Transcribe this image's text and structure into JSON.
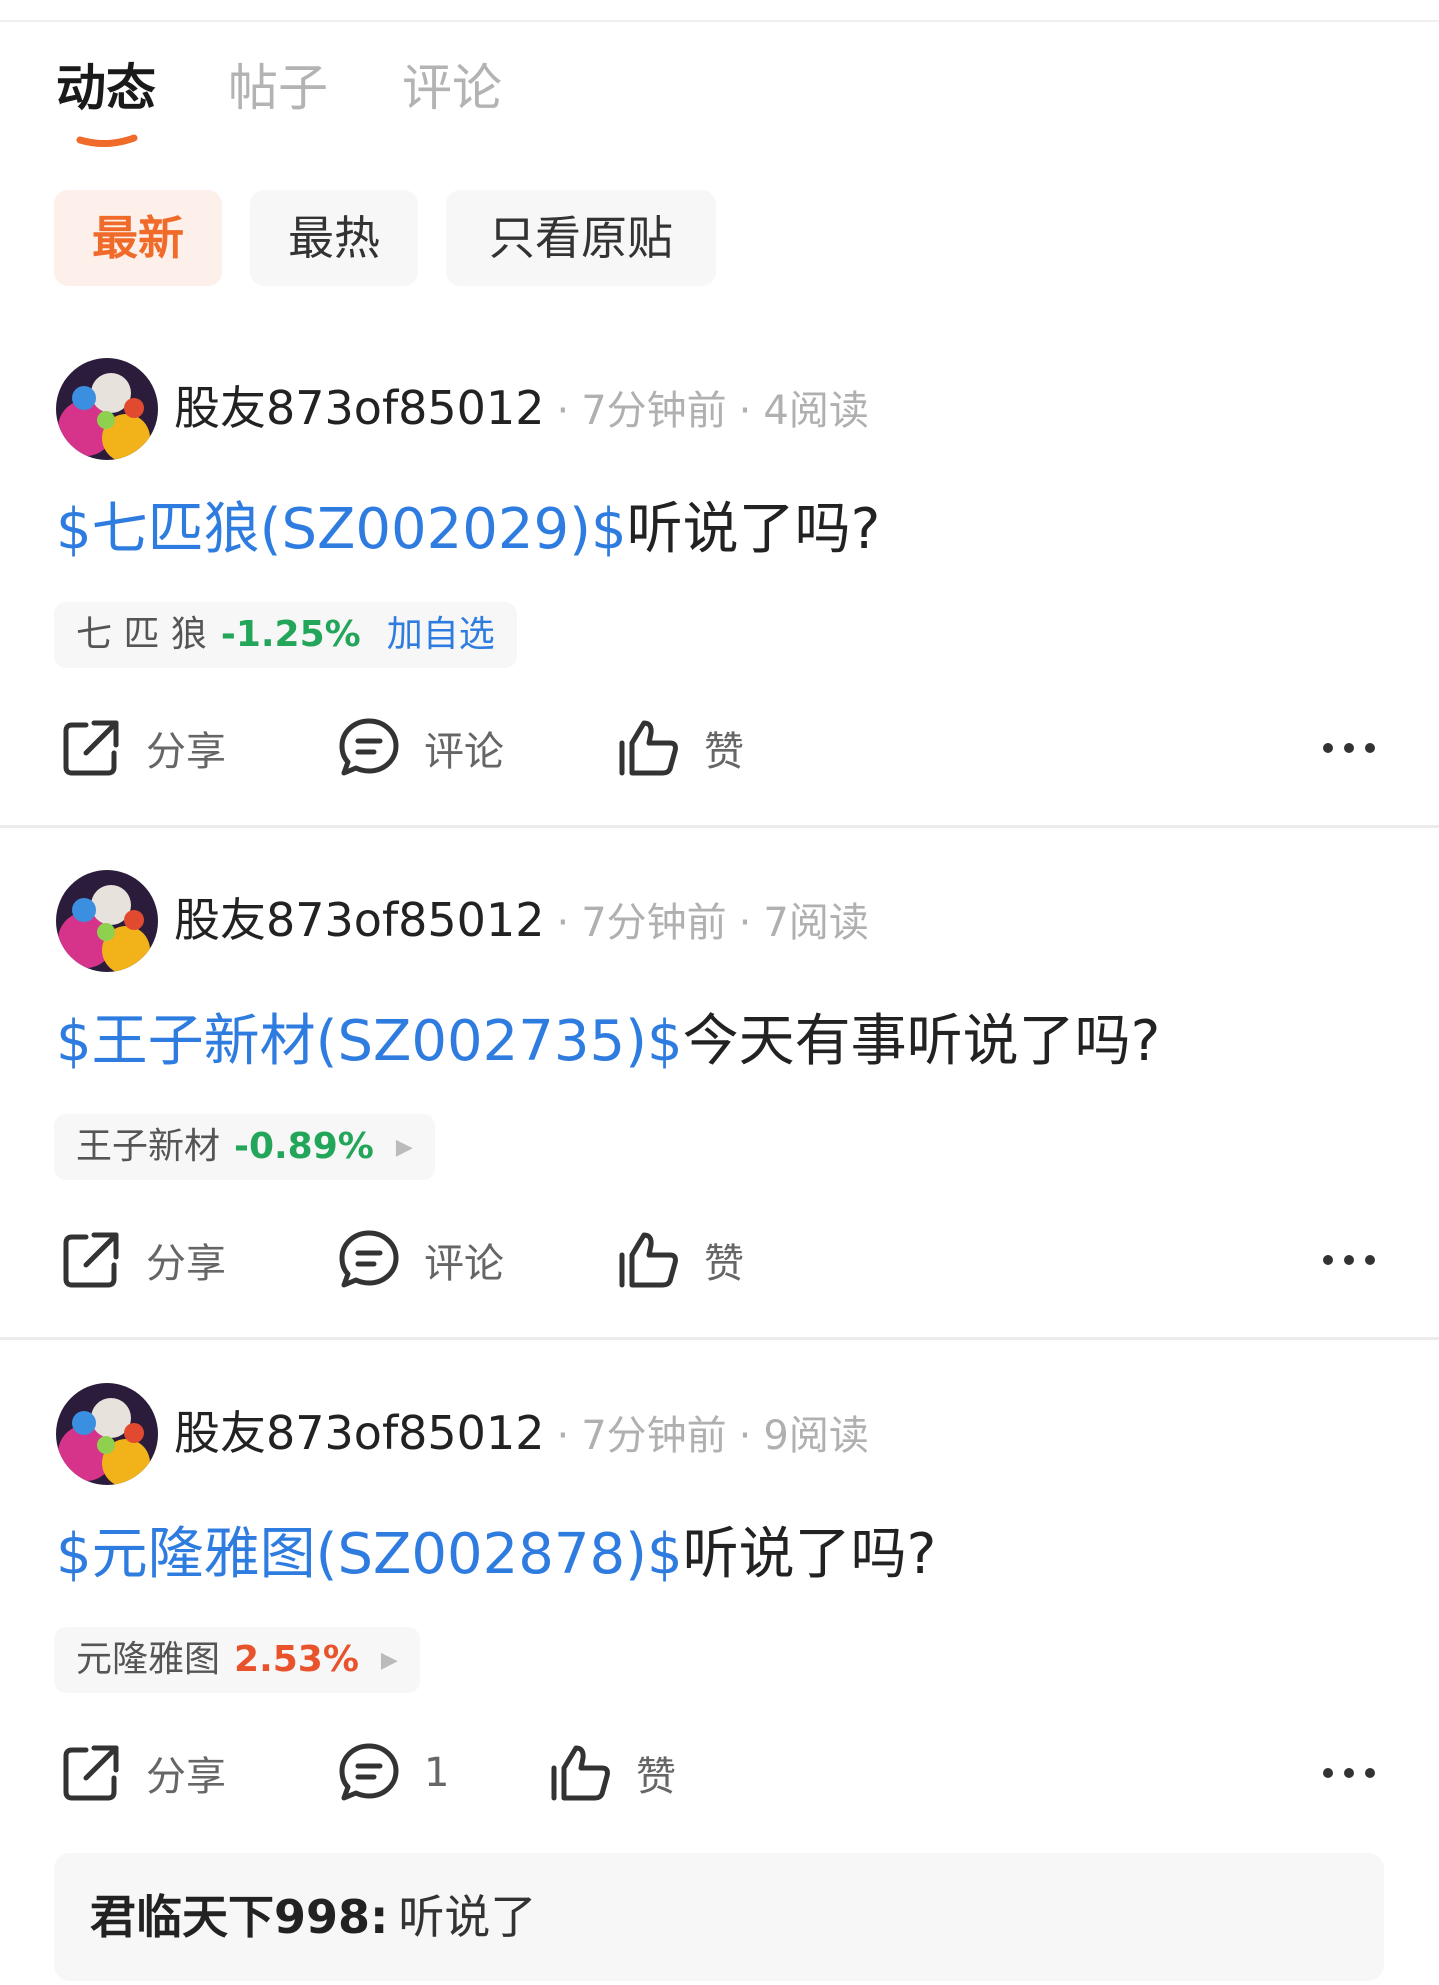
{
  "tabs": [
    {
      "label": "动态"
    },
    {
      "label": "帖子"
    },
    {
      "label": "评论"
    }
  ],
  "filters": [
    {
      "label": "最新"
    },
    {
      "label": "最热"
    },
    {
      "label": "只看原贴"
    }
  ],
  "colors": {
    "accent": "#f06a2a",
    "link": "#2f7ce0",
    "down": "#23a55a",
    "up": "#e8532b"
  },
  "posts": [
    {
      "username": "股友873of85012",
      "time": "7分钟前",
      "reads": "4阅读",
      "stock_link": "$七匹狼(SZ002029)$",
      "text": "听说了吗?",
      "chip": {
        "name": "七 匹 狼",
        "change": "-1.25%",
        "follow": "加自选"
      },
      "actions": {
        "share": "分享",
        "comment": "评论",
        "like": "赞"
      }
    },
    {
      "username": "股友873of85012",
      "time": "7分钟前",
      "reads": "7阅读",
      "stock_link": "$王子新材(SZ002735)$",
      "text": "今天有事听说了吗?",
      "chip": {
        "name": "王子新材",
        "change": "-0.89%"
      },
      "actions": {
        "share": "分享",
        "comment": "评论",
        "like": "赞"
      }
    },
    {
      "username": "股友873of85012",
      "time": "7分钟前",
      "reads": "9阅读",
      "stock_link": "$元隆雅图(SZ002878)$",
      "text": "听说了吗?",
      "chip": {
        "name": "元隆雅图",
        "change": "2.53%"
      },
      "actions": {
        "share": "分享",
        "comment": "1",
        "like": "赞"
      },
      "reply": {
        "user": "君临天下998:",
        "text": "听说了"
      }
    }
  ],
  "icons": {
    "share": "share-icon",
    "comment": "comment-icon",
    "like": "thumbs-up-icon",
    "more": "more-dots-icon"
  }
}
